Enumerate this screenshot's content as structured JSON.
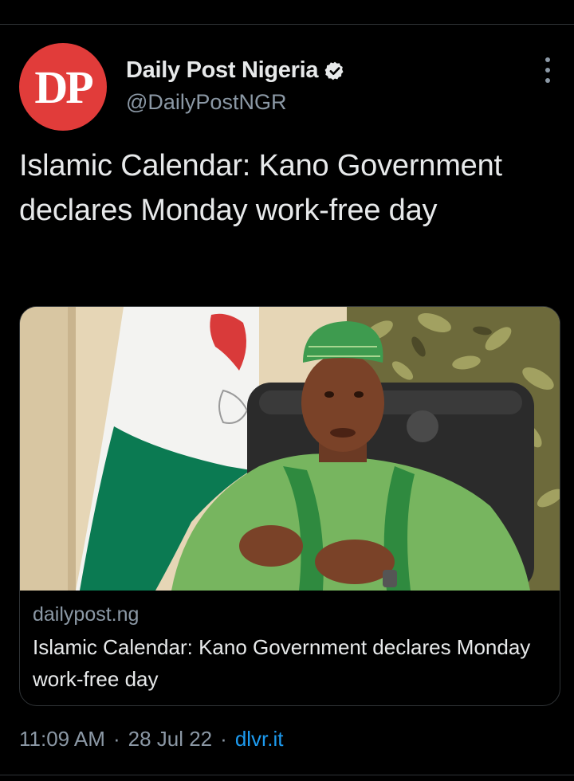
{
  "tweet": {
    "avatar_text": "DP",
    "display_name": "Daily Post Nigeria",
    "handle": "@DailyPostNGR",
    "verified": true,
    "text": "Islamic Calendar: Kano Government declares Monday work-free day",
    "menu_icon": "more-dots-icon"
  },
  "card": {
    "domain": "dailypost.ng",
    "title": "Islamic Calendar: Kano Government declares Monday work-free day",
    "image_description_icon": "photo"
  },
  "meta": {
    "time": "11:09 AM",
    "sep1": "·",
    "date": "28 Jul 22",
    "sep2": "·",
    "source": "dlvr.it"
  },
  "colors": {
    "background": "#000000",
    "avatar": "#e13c3a",
    "muted": "#8b98a5",
    "link": "#1d9bf0",
    "border": "#2f3336"
  }
}
